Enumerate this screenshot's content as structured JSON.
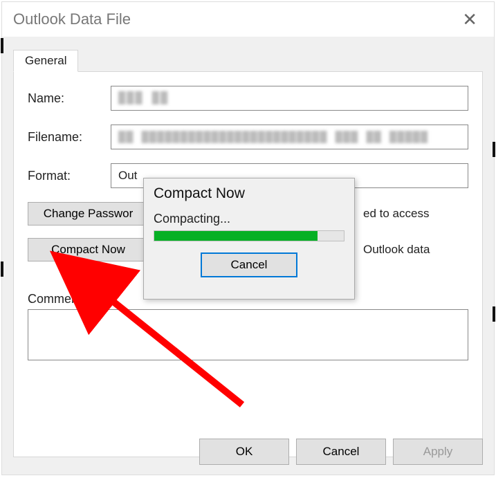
{
  "window": {
    "title": "Outlook Data File",
    "close_symbol": "✕"
  },
  "tab": {
    "general": "General"
  },
  "fields": {
    "name_label": "Name:",
    "name_value": "",
    "filename_label": "Filename:",
    "filename_value": "",
    "format_label": "Format:",
    "format_prefix": "Out"
  },
  "buttons": {
    "change_password": "Change Passwor",
    "change_password_desc": "ed to access",
    "compact_now": "Compact Now",
    "compact_now_desc": "Outlook data",
    "ok": "OK",
    "cancel": "Cancel",
    "apply": "Apply"
  },
  "comment": {
    "label": "Comment",
    "value": ""
  },
  "modal": {
    "title": "Compact Now",
    "status": "Compacting...",
    "progress_percent": 86,
    "cancel": "Cancel"
  },
  "redaction": {
    "name_block": "███  ██",
    "filename_block": "██ ████████████████████████ ███ ██  █████"
  }
}
